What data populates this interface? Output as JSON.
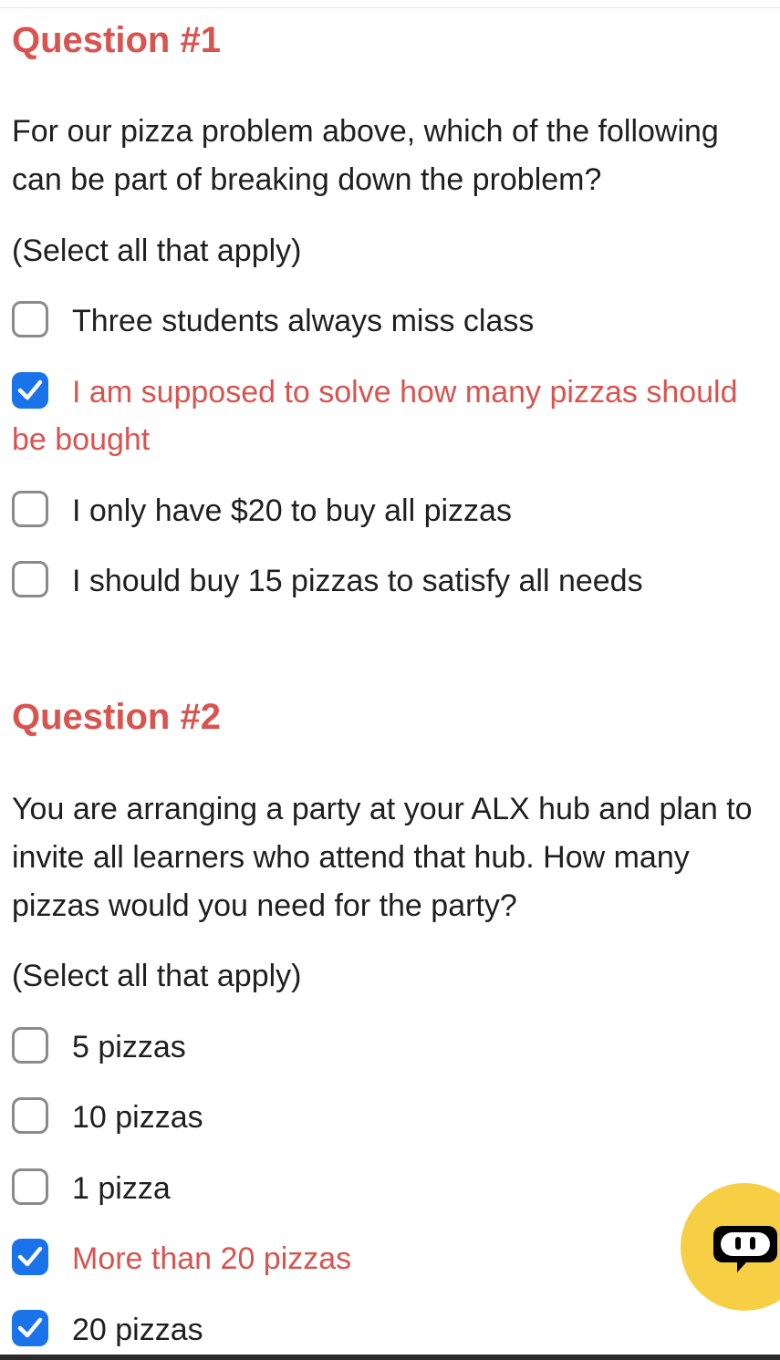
{
  "questions": [
    {
      "title": "Question #1",
      "text": "For our pizza problem above, which of the following can be part of breaking down the problem?",
      "hint": "(Select all that apply)",
      "options": [
        {
          "label": "Three students always miss class",
          "checked": false
        },
        {
          "label": "I am supposed to solve how many pizzas should be bought",
          "checked": true
        },
        {
          "label": "I only have $20 to buy all pizzas",
          "checked": false
        },
        {
          "label": "I should buy 15 pizzas to satisfy all needs",
          "checked": false
        }
      ]
    },
    {
      "title": "Question #2",
      "text": "You are arranging a party at your ALX hub and plan to invite all learners who attend that hub. How many pizzas would you need for the party?",
      "hint": "(Select all that apply)",
      "options": [
        {
          "label": "5 pizzas",
          "checked": false
        },
        {
          "label": "10 pizzas",
          "checked": false
        },
        {
          "label": "1 pizza",
          "checked": false
        },
        {
          "label": "More than 20 pizzas",
          "checked": true
        },
        {
          "label": "20 pizzas",
          "checked": true
        }
      ]
    }
  ],
  "colors": {
    "accent": "#d9534f",
    "checkbox_checked": "#1a73e8",
    "chat_button": "#f7cf45"
  },
  "chat_button": {
    "icon": "chat-bot-icon"
  }
}
